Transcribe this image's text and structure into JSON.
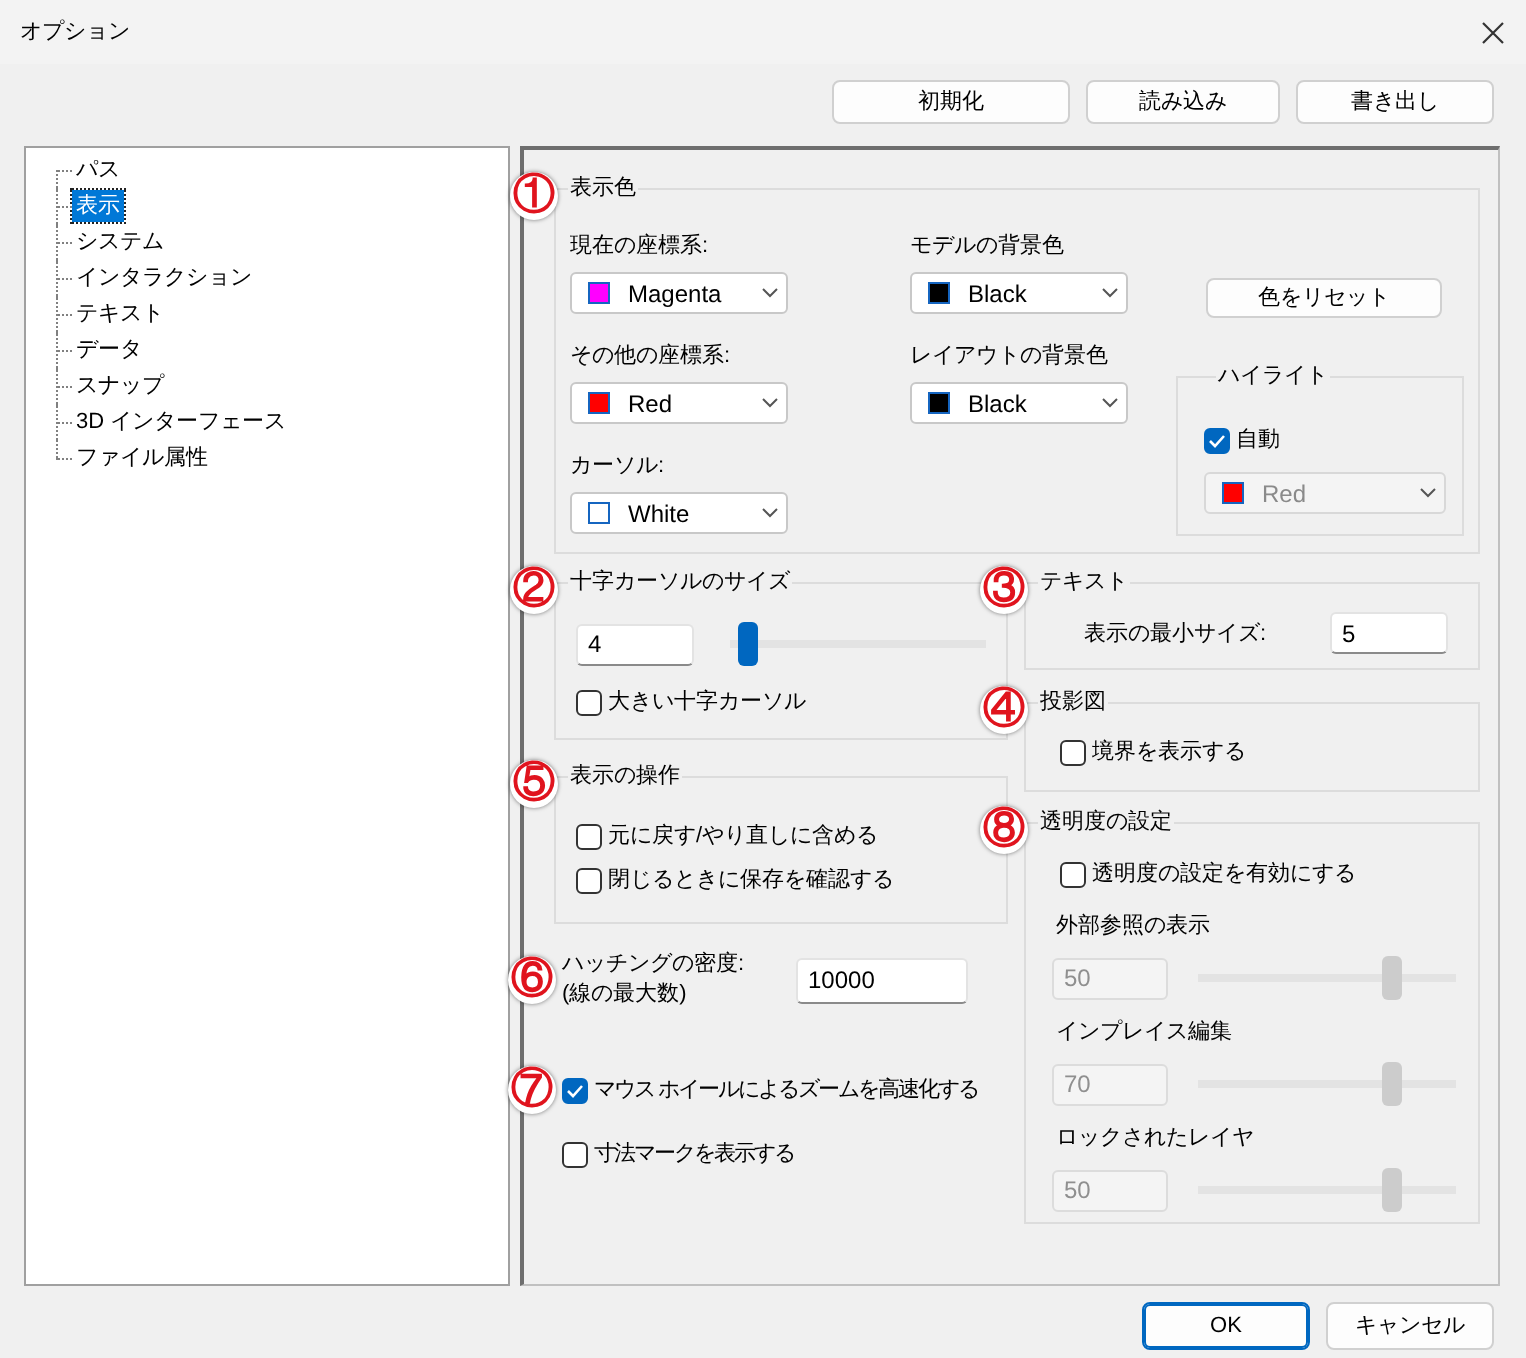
{
  "window": {
    "title": "オプション"
  },
  "toolbar": {
    "buttons": [
      "初期化",
      "読み込み",
      "書き出し"
    ]
  },
  "tree": {
    "items": [
      {
        "label": "パス",
        "selected": false
      },
      {
        "label": "表示",
        "selected": true
      },
      {
        "label": "システム",
        "selected": false
      },
      {
        "label": "インタラクション",
        "selected": false
      },
      {
        "label": "テキスト",
        "selected": false
      },
      {
        "label": "データ",
        "selected": false
      },
      {
        "label": "スナップ",
        "selected": false
      },
      {
        "label": "3D インターフェース",
        "selected": false
      },
      {
        "label": "ファイル属性",
        "selected": false
      }
    ]
  },
  "display_colors": {
    "marker": "①",
    "title": "表示色",
    "columns": [
      {
        "fields": [
          {
            "label": "現在の座標系:",
            "value": "Magenta",
            "color": "#ff00ff"
          },
          {
            "label": "その他の座標系:",
            "value": "Red",
            "color": "#ff0000"
          },
          {
            "label": "カーソル:",
            "value": "White",
            "color": "#ffffff"
          }
        ]
      },
      {
        "fields": [
          {
            "label": "モデルの背景色",
            "value": "Black",
            "color": "#000000"
          },
          {
            "label": "レイアウトの背景色",
            "value": "Black",
            "color": "#000000"
          }
        ]
      }
    ],
    "reset_button": "色をリセット",
    "highlight": {
      "title": "ハイライト",
      "auto": {
        "label": "自動",
        "checked": true
      },
      "dropdown": {
        "value": "Red",
        "color": "#ff0000",
        "disabled": true
      }
    }
  },
  "crosshair_size": {
    "marker": "②",
    "title": "十字カーソルのサイズ",
    "value": "4",
    "level": 0.03,
    "checkbox": {
      "label": "大きい十字カーソル",
      "checked": false
    }
  },
  "text": {
    "marker": "③",
    "title": "テキスト",
    "label": "表示の最小サイズ:",
    "value": "5"
  },
  "projection": {
    "marker": "④",
    "title": "投影図",
    "checkbox": {
      "label": "境界を表示する",
      "checked": false
    }
  },
  "view_operations": {
    "marker": "⑤",
    "title": "表示の操作",
    "checkboxes": [
      {
        "label": "元に戻す/やり直しに含める",
        "checked": false
      },
      {
        "label": "閉じるときに保存を確認する",
        "checked": false
      }
    ]
  },
  "hatching": {
    "marker": "⑥",
    "label": "ハッチングの密度:\n(線の最大数)",
    "value": "10000"
  },
  "extra_options": [
    {
      "marker": "⑦",
      "label": "マウス ホイールによるズームを高速化する",
      "checked": true
    },
    {
      "label": "寸法マークを表示する",
      "checked": false
    }
  ],
  "transparency": {
    "marker": "⑧",
    "title": "透明度の設定",
    "enable": {
      "label": "透明度の設定を有効にする",
      "checked": false
    },
    "sliders": [
      {
        "label": "外部参照の表示",
        "value": "50",
        "level": 0.77,
        "disabled": true
      },
      {
        "label": "インプレイス編集",
        "value": "70",
        "level": 0.77,
        "disabled": true
      },
      {
        "label": "ロックされたレイヤ",
        "value": "50",
        "level": 0.77,
        "disabled": true
      }
    ]
  },
  "footer": {
    "buttons": [
      {
        "label": "OK",
        "default": true
      },
      {
        "label": "キャンセル",
        "default": false
      }
    ]
  }
}
